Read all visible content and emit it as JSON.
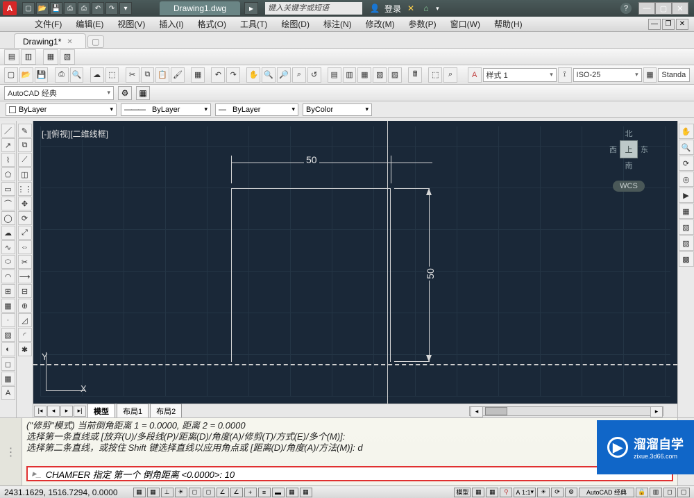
{
  "app": {
    "logo_char": "A",
    "title": "Drawing1.dwg",
    "search_placeholder": "键入关键字或短语",
    "login_label": "登录",
    "help_icon": "?"
  },
  "menubar": {
    "items": [
      "文件(F)",
      "编辑(E)",
      "视图(V)",
      "插入(I)",
      "格式(O)",
      "工具(T)",
      "绘图(D)",
      "标注(N)",
      "修改(M)",
      "参数(P)",
      "窗口(W)",
      "帮助(H)"
    ]
  },
  "doctab": {
    "label": "Drawing1*"
  },
  "workspace": {
    "combo": "AutoCAD 经典"
  },
  "style": {
    "combo": "样式 1",
    "dim_combo": "ISO-25",
    "std_combo": "Standa"
  },
  "layer": {
    "layer_combo": "ByLayer",
    "ltype_combo": "ByLayer",
    "lweight_combo": "ByLayer",
    "color_combo": "ByColor"
  },
  "drawing": {
    "view_label": "[-][俯视][二维线框]",
    "dim_h": "50",
    "dim_v": "50",
    "ucs_y": "Y",
    "ucs_x": "X"
  },
  "viewcube": {
    "n": "北",
    "s": "南",
    "e": "东",
    "w": "西",
    "top": "上",
    "wcs": "WCS"
  },
  "model_tabs": {
    "model": "模型",
    "layout1": "布局1",
    "layout2": "布局2"
  },
  "cmd": {
    "hist1": "(\"修剪\"模式) 当前倒角距离 1 = 0.0000, 距离 2 = 0.0000",
    "hist2": "选择第一条直线或 [放弃(U)/多段线(P)/距离(D)/角度(A)/修剪(T)/方式(E)/多个(M)]:",
    "hist3": "选择第二条直线，或按住 Shift 键选择直线以应用角点或 [距离(D)/角度(A)/方法(M)]: d",
    "prompt": "CHAMFER 指定 第一个 倒角距离 <0.0000>: 10"
  },
  "status": {
    "coords": "2431.1629, 1516.7294, 0.0000",
    "model": "模型",
    "scale": "1:1",
    "ann_btn": "A",
    "autocad_label": "AutoCAD 经典"
  },
  "watermark": {
    "text": "溜溜自学",
    "url": "zixue.3d66.com"
  },
  "chart_data": {
    "type": "table",
    "note": "CAD drawing of 50x50 square with horizontal and vertical dimension 50"
  }
}
